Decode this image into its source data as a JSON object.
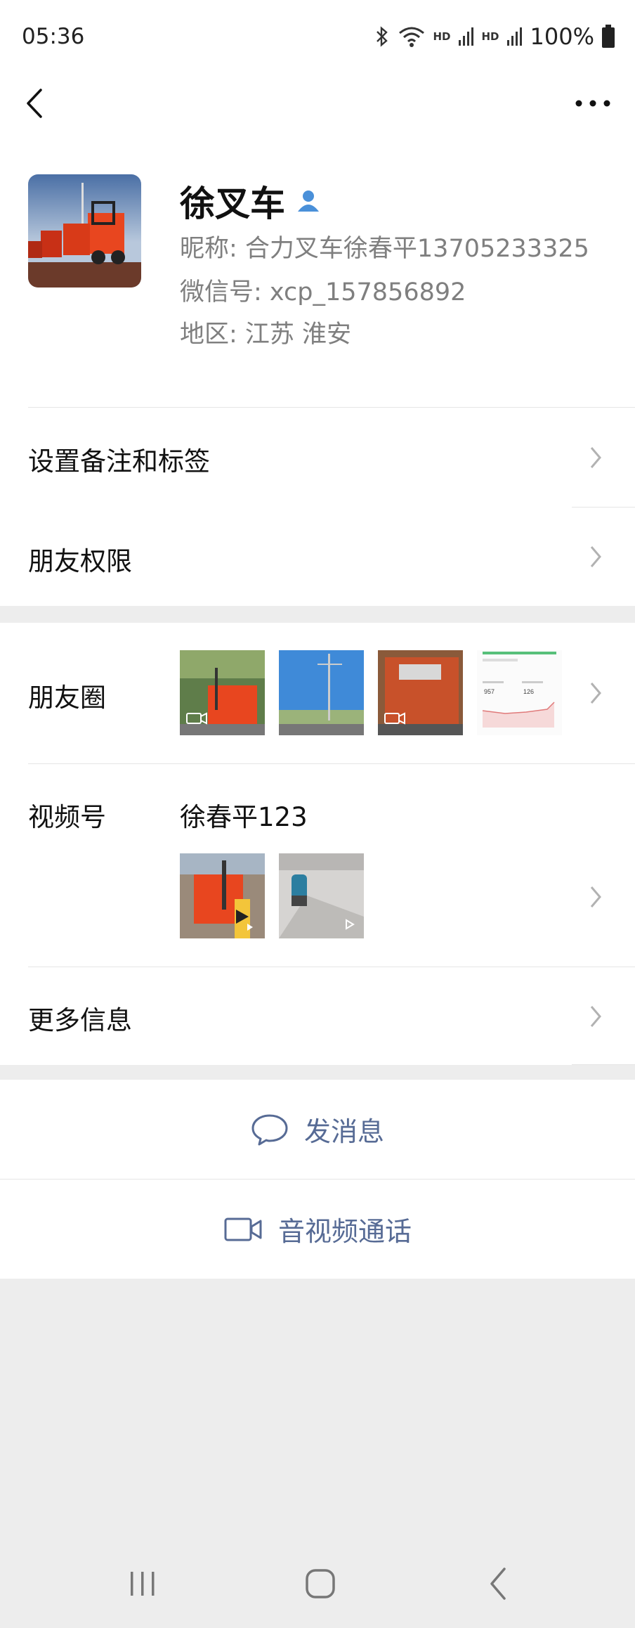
{
  "status_bar": {
    "time": "05:36",
    "hd1": "HD",
    "hd2": "HD",
    "battery": "100%",
    "icons": [
      "bluetooth-icon",
      "wifi-icon",
      "signal-icon",
      "signal-icon",
      "battery-icon"
    ]
  },
  "profile": {
    "name": "徐叉车",
    "nickname": "昵称:  合力叉车徐春平13705233325",
    "wechat_id": "微信号:  xcp_157856892",
    "region": "地区:  江苏  淮安"
  },
  "rows": {
    "remark": "设置备注和标签",
    "permissions": "朋友权限",
    "moments": "朋友圈",
    "channels": "视频号",
    "channels_name": "徐春平123",
    "more_info": "更多信息"
  },
  "moments_thumbs": {
    "chart_value_1": "957",
    "chart_value_2": "126"
  },
  "actions": {
    "message": "发消息",
    "call": "音视频通话"
  },
  "colors": {
    "link": "#576b95",
    "background": "#ededed",
    "accent_forklift": "#e8461f"
  }
}
